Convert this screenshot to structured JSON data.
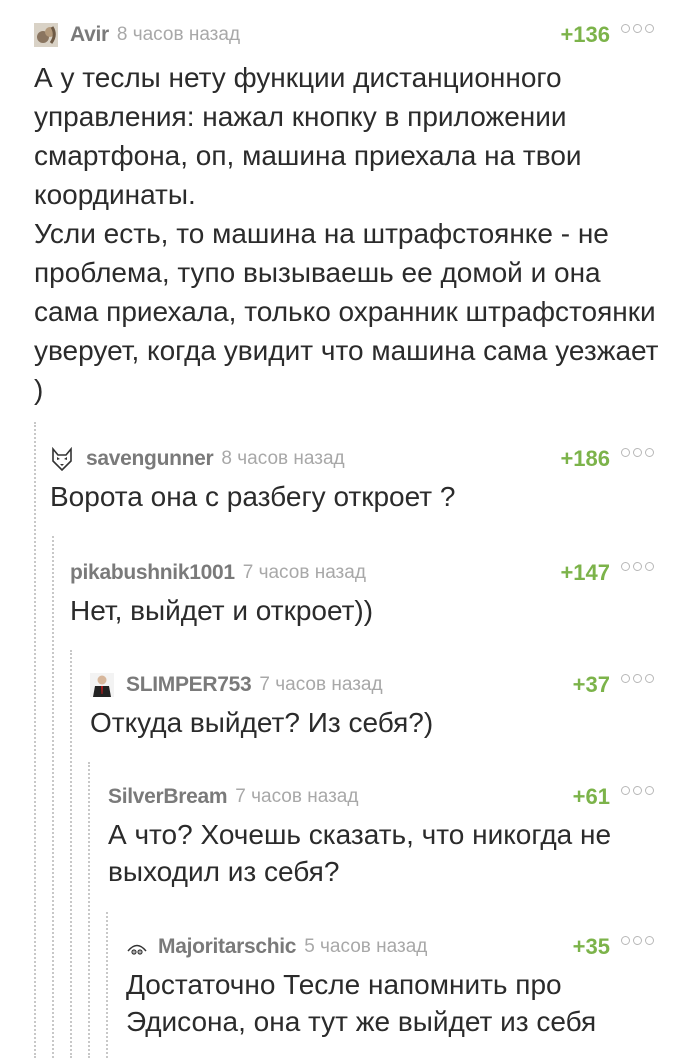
{
  "comments": [
    {
      "username": "Avir",
      "time": "8 часов назад",
      "rating": "+136",
      "text": "А у теслы нету функции дистанционного управления: нажал кнопку в приложении смартфона, оп, машина приехала на твои координаты.\nУсли есть, то машина на штрафстоянке - не проблема, тупо вызываешь ее домой и она сама приехала, только охранник штрафстоянки уверует, когда увидит что машина сама уезжает )",
      "avatar_icon": "squirrel-avatar-icon"
    },
    {
      "username": "savengunner",
      "time": "8 часов назад",
      "rating": "+186",
      "text": "Ворота она с разбегу откроет ?",
      "avatar_icon": "husky-avatar-icon"
    },
    {
      "username": "pikabushnik1001",
      "time": "7 часов назад",
      "rating": "+147",
      "text": "Нет, выйдет и откроет))"
    },
    {
      "username": "SLIMPER753",
      "time": "7 часов назад",
      "rating": "+37",
      "text": "Откуда выйдет? Из себя?)",
      "avatar_icon": "hitman-avatar-icon"
    },
    {
      "username": "SilverBream",
      "time": "7 часов назад",
      "rating": "+61",
      "text": "А что? Хочешь сказать, что никогда не выходил из себя?"
    },
    {
      "username": "Majoritarschic",
      "time": "5 часов назад",
      "rating": "+35",
      "text": "Достаточно Тесле напомнить про Эдисона, она тут же выйдет из себя",
      "avatar_icon": "face-avatar-icon"
    }
  ],
  "colors": {
    "rating": "#7cb34a",
    "username": "#7a7a7a",
    "time": "#a8a8a8",
    "text": "#2b2b2b",
    "thread_line": "#c8c8c8"
  }
}
